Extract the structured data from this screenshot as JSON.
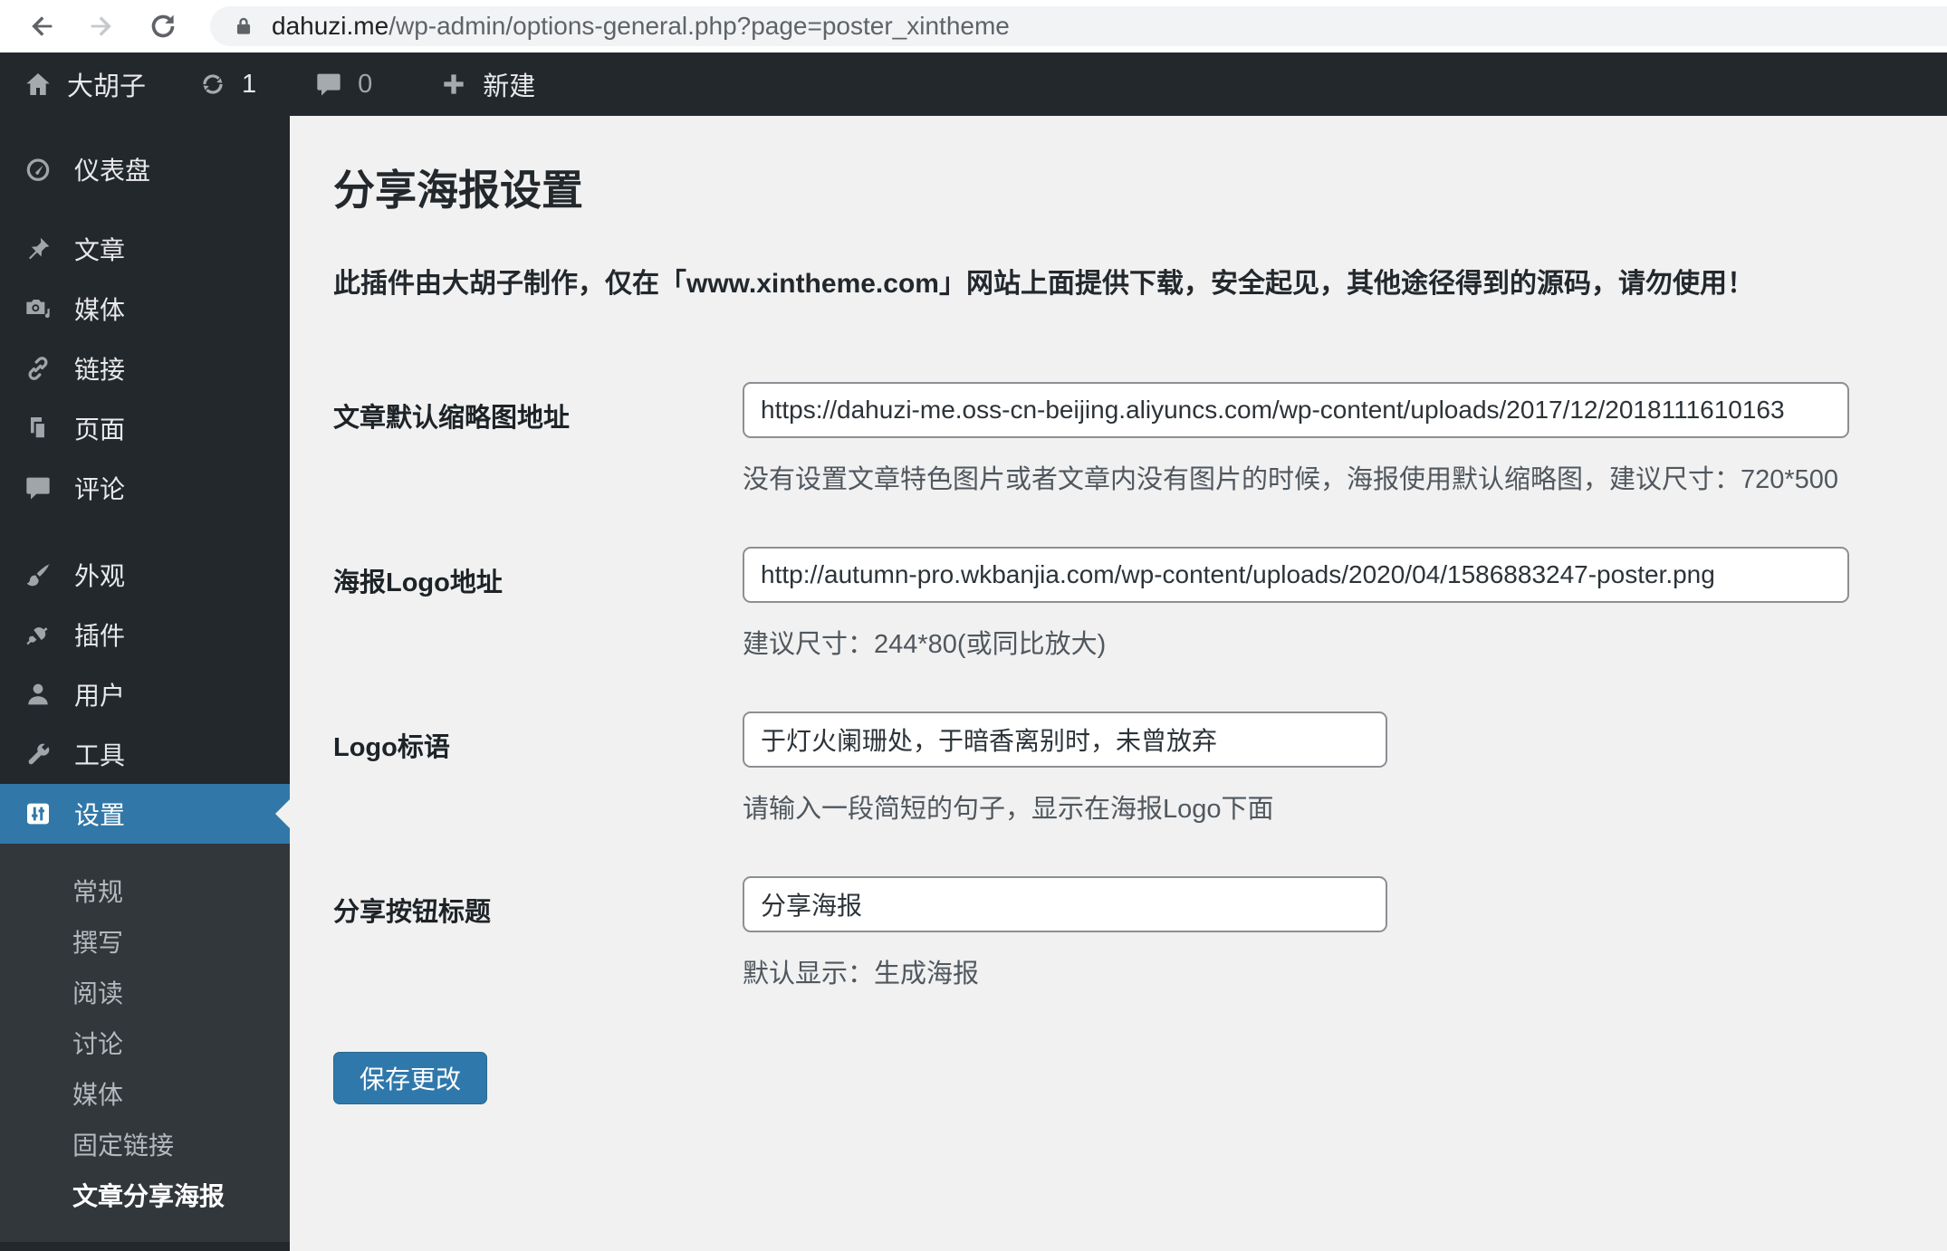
{
  "browser": {
    "url_domain": "dahuzi.me",
    "url_path": "/wp-admin/options-general.php?page=poster_xintheme"
  },
  "admin_bar": {
    "site_name": "大胡子",
    "update_count": "1",
    "comment_count": "0",
    "new_label": "新建"
  },
  "sidebar": {
    "menu": [
      {
        "label": "仪表盘"
      },
      {
        "label": "文章"
      },
      {
        "label": "媒体"
      },
      {
        "label": "链接"
      },
      {
        "label": "页面"
      },
      {
        "label": "评论"
      },
      {
        "label": "外观"
      },
      {
        "label": "插件"
      },
      {
        "label": "用户"
      },
      {
        "label": "工具"
      },
      {
        "label": "设置"
      }
    ],
    "settings_submenu": [
      {
        "label": "常规"
      },
      {
        "label": "撰写"
      },
      {
        "label": "阅读"
      },
      {
        "label": "讨论"
      },
      {
        "label": "媒体"
      },
      {
        "label": "固定链接"
      },
      {
        "label": "文章分享海报"
      }
    ]
  },
  "main": {
    "title": "分享海报设置",
    "notice": "此插件由大胡子制作，仅在「www.xintheme.com」网站上面提供下载，安全起见，其他途径得到的源码，请勿使用！",
    "fields": [
      {
        "label": "文章默认缩略图地址",
        "value": "https://dahuzi-me.oss-cn-beijing.aliyuncs.com/wp-content/uploads/2017/12/2018111610163",
        "help": "没有设置文章特色图片或者文章内没有图片的时候，海报使用默认缩略图，建议尺寸：720*500"
      },
      {
        "label": "海报Logo地址",
        "value": "http://autumn-pro.wkbanjia.com/wp-content/uploads/2020/04/1586883247-poster.png",
        "help": "建议尺寸：244*80(或同比放大)"
      },
      {
        "label": "Logo标语",
        "value": "于灯火阑珊处，于暗香离别时，未曾放弃",
        "help": "请输入一段简短的句子，显示在海报Logo下面"
      },
      {
        "label": "分享按钮标题",
        "value": "分享海报",
        "help": "默认显示：生成海报"
      }
    ],
    "save_button": "保存更改"
  },
  "colors": {
    "admin_dark": "#23282d",
    "submenu_dark": "#32373c",
    "active_blue": "#3178a8",
    "button_blue": "#2f78ab",
    "content_bg": "#f1f1f1"
  }
}
